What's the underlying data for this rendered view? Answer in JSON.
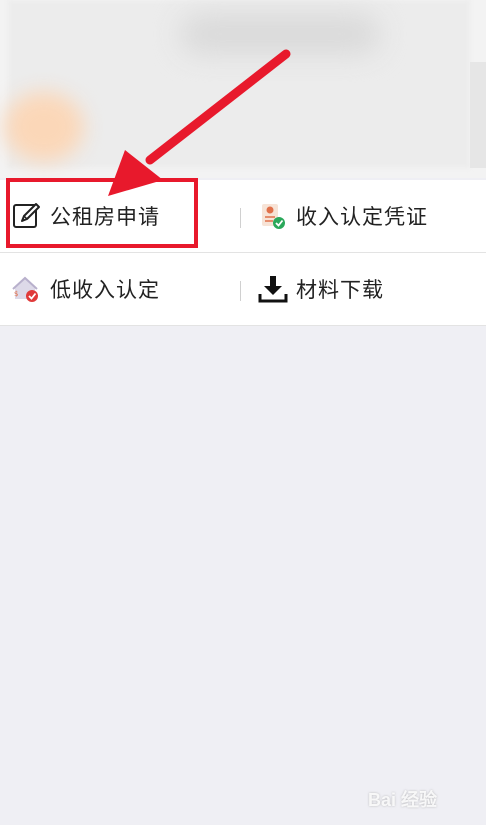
{
  "menu": {
    "rows": [
      {
        "left": {
          "label": "公租房申请",
          "icon": "edit-pen-icon"
        },
        "right": {
          "label": "收入认定凭证",
          "icon": "certificate-check-icon"
        }
      },
      {
        "left": {
          "label": "低收入认定",
          "icon": "house-check-icon"
        },
        "right": {
          "label": "材料下载",
          "icon": "download-icon"
        }
      }
    ]
  },
  "colors": {
    "background": "#efeff4",
    "highlight": "#e8192c",
    "text": "#222222"
  },
  "watermark": {
    "text": "Bai 经验"
  }
}
